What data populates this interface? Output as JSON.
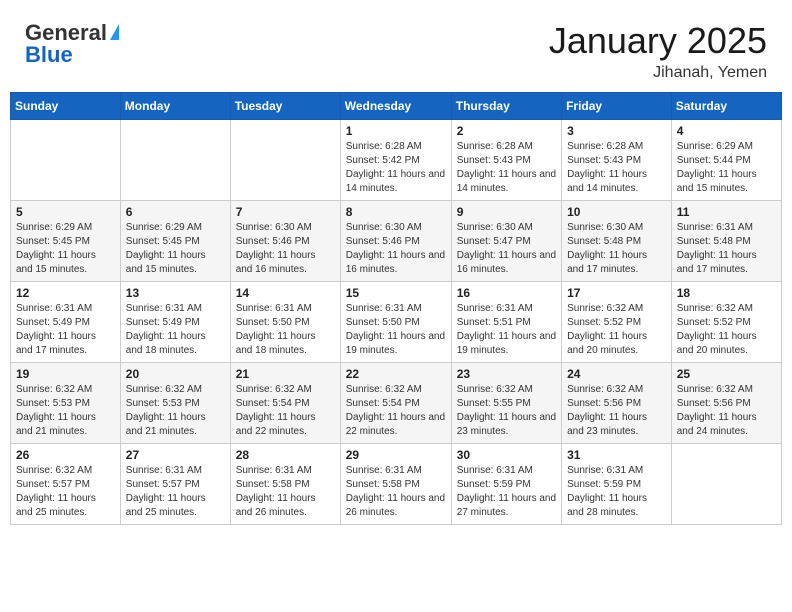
{
  "header": {
    "logo_general": "General",
    "logo_blue": "Blue",
    "month": "January 2025",
    "location": "Jihanah, Yemen"
  },
  "days_of_week": [
    "Sunday",
    "Monday",
    "Tuesday",
    "Wednesday",
    "Thursday",
    "Friday",
    "Saturday"
  ],
  "weeks": [
    [
      {
        "day": "",
        "sunrise": "",
        "sunset": "",
        "daylight": ""
      },
      {
        "day": "",
        "sunrise": "",
        "sunset": "",
        "daylight": ""
      },
      {
        "day": "",
        "sunrise": "",
        "sunset": "",
        "daylight": ""
      },
      {
        "day": "1",
        "sunrise": "Sunrise: 6:28 AM",
        "sunset": "Sunset: 5:42 PM",
        "daylight": "Daylight: 11 hours and 14 minutes."
      },
      {
        "day": "2",
        "sunrise": "Sunrise: 6:28 AM",
        "sunset": "Sunset: 5:43 PM",
        "daylight": "Daylight: 11 hours and 14 minutes."
      },
      {
        "day": "3",
        "sunrise": "Sunrise: 6:28 AM",
        "sunset": "Sunset: 5:43 PM",
        "daylight": "Daylight: 11 hours and 14 minutes."
      },
      {
        "day": "4",
        "sunrise": "Sunrise: 6:29 AM",
        "sunset": "Sunset: 5:44 PM",
        "daylight": "Daylight: 11 hours and 15 minutes."
      }
    ],
    [
      {
        "day": "5",
        "sunrise": "Sunrise: 6:29 AM",
        "sunset": "Sunset: 5:45 PM",
        "daylight": "Daylight: 11 hours and 15 minutes."
      },
      {
        "day": "6",
        "sunrise": "Sunrise: 6:29 AM",
        "sunset": "Sunset: 5:45 PM",
        "daylight": "Daylight: 11 hours and 15 minutes."
      },
      {
        "day": "7",
        "sunrise": "Sunrise: 6:30 AM",
        "sunset": "Sunset: 5:46 PM",
        "daylight": "Daylight: 11 hours and 16 minutes."
      },
      {
        "day": "8",
        "sunrise": "Sunrise: 6:30 AM",
        "sunset": "Sunset: 5:46 PM",
        "daylight": "Daylight: 11 hours and 16 minutes."
      },
      {
        "day": "9",
        "sunrise": "Sunrise: 6:30 AM",
        "sunset": "Sunset: 5:47 PM",
        "daylight": "Daylight: 11 hours and 16 minutes."
      },
      {
        "day": "10",
        "sunrise": "Sunrise: 6:30 AM",
        "sunset": "Sunset: 5:48 PM",
        "daylight": "Daylight: 11 hours and 17 minutes."
      },
      {
        "day": "11",
        "sunrise": "Sunrise: 6:31 AM",
        "sunset": "Sunset: 5:48 PM",
        "daylight": "Daylight: 11 hours and 17 minutes."
      }
    ],
    [
      {
        "day": "12",
        "sunrise": "Sunrise: 6:31 AM",
        "sunset": "Sunset: 5:49 PM",
        "daylight": "Daylight: 11 hours and 17 minutes."
      },
      {
        "day": "13",
        "sunrise": "Sunrise: 6:31 AM",
        "sunset": "Sunset: 5:49 PM",
        "daylight": "Daylight: 11 hours and 18 minutes."
      },
      {
        "day": "14",
        "sunrise": "Sunrise: 6:31 AM",
        "sunset": "Sunset: 5:50 PM",
        "daylight": "Daylight: 11 hours and 18 minutes."
      },
      {
        "day": "15",
        "sunrise": "Sunrise: 6:31 AM",
        "sunset": "Sunset: 5:50 PM",
        "daylight": "Daylight: 11 hours and 19 minutes."
      },
      {
        "day": "16",
        "sunrise": "Sunrise: 6:31 AM",
        "sunset": "Sunset: 5:51 PM",
        "daylight": "Daylight: 11 hours and 19 minutes."
      },
      {
        "day": "17",
        "sunrise": "Sunrise: 6:32 AM",
        "sunset": "Sunset: 5:52 PM",
        "daylight": "Daylight: 11 hours and 20 minutes."
      },
      {
        "day": "18",
        "sunrise": "Sunrise: 6:32 AM",
        "sunset": "Sunset: 5:52 PM",
        "daylight": "Daylight: 11 hours and 20 minutes."
      }
    ],
    [
      {
        "day": "19",
        "sunrise": "Sunrise: 6:32 AM",
        "sunset": "Sunset: 5:53 PM",
        "daylight": "Daylight: 11 hours and 21 minutes."
      },
      {
        "day": "20",
        "sunrise": "Sunrise: 6:32 AM",
        "sunset": "Sunset: 5:53 PM",
        "daylight": "Daylight: 11 hours and 21 minutes."
      },
      {
        "day": "21",
        "sunrise": "Sunrise: 6:32 AM",
        "sunset": "Sunset: 5:54 PM",
        "daylight": "Daylight: 11 hours and 22 minutes."
      },
      {
        "day": "22",
        "sunrise": "Sunrise: 6:32 AM",
        "sunset": "Sunset: 5:54 PM",
        "daylight": "Daylight: 11 hours and 22 minutes."
      },
      {
        "day": "23",
        "sunrise": "Sunrise: 6:32 AM",
        "sunset": "Sunset: 5:55 PM",
        "daylight": "Daylight: 11 hours and 23 minutes."
      },
      {
        "day": "24",
        "sunrise": "Sunrise: 6:32 AM",
        "sunset": "Sunset: 5:56 PM",
        "daylight": "Daylight: 11 hours and 23 minutes."
      },
      {
        "day": "25",
        "sunrise": "Sunrise: 6:32 AM",
        "sunset": "Sunset: 5:56 PM",
        "daylight": "Daylight: 11 hours and 24 minutes."
      }
    ],
    [
      {
        "day": "26",
        "sunrise": "Sunrise: 6:32 AM",
        "sunset": "Sunset: 5:57 PM",
        "daylight": "Daylight: 11 hours and 25 minutes."
      },
      {
        "day": "27",
        "sunrise": "Sunrise: 6:31 AM",
        "sunset": "Sunset: 5:57 PM",
        "daylight": "Daylight: 11 hours and 25 minutes."
      },
      {
        "day": "28",
        "sunrise": "Sunrise: 6:31 AM",
        "sunset": "Sunset: 5:58 PM",
        "daylight": "Daylight: 11 hours and 26 minutes."
      },
      {
        "day": "29",
        "sunrise": "Sunrise: 6:31 AM",
        "sunset": "Sunset: 5:58 PM",
        "daylight": "Daylight: 11 hours and 26 minutes."
      },
      {
        "day": "30",
        "sunrise": "Sunrise: 6:31 AM",
        "sunset": "Sunset: 5:59 PM",
        "daylight": "Daylight: 11 hours and 27 minutes."
      },
      {
        "day": "31",
        "sunrise": "Sunrise: 6:31 AM",
        "sunset": "Sunset: 5:59 PM",
        "daylight": "Daylight: 11 hours and 28 minutes."
      },
      {
        "day": "",
        "sunrise": "",
        "sunset": "",
        "daylight": ""
      }
    ]
  ]
}
